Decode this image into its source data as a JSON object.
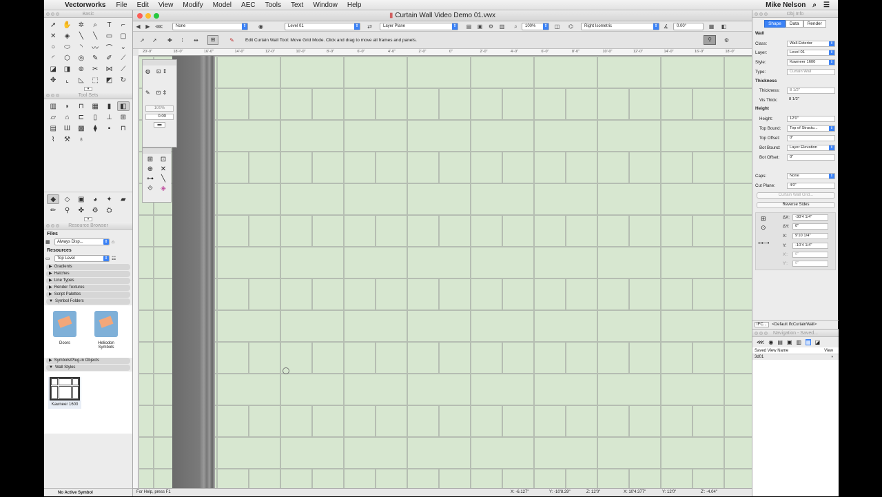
{
  "menubar": {
    "app": "Vectorworks",
    "items": [
      "File",
      "Edit",
      "View",
      "Modify",
      "Model",
      "AEC",
      "Tools",
      "Text",
      "Window",
      "Help"
    ],
    "user": "Mike Nelson"
  },
  "left": {
    "basic_title": "Basic",
    "toolsets_title": "Tool Sets",
    "rb_title": "Resource Browser",
    "files_label": "Files",
    "files_value": "Always Disp...",
    "resources_label": "Resources",
    "resources_value": "Top Level",
    "folders": [
      "Gradients",
      "Hatches",
      "Line Types",
      "Render Textures",
      "Script Palettes",
      "Symbol Folders"
    ],
    "symbol_items": [
      "Doors",
      "Heliodon Symbols"
    ],
    "folders2": [
      "Symbols/Plug-in Objects",
      "Wall Styles"
    ],
    "wall_style": "Kawneer 1600",
    "footer": "No Active Symbol"
  },
  "doc": {
    "title": "Curtain Wall Video Demo 01.vwx",
    "class_sel": "None",
    "layer_sel": "Level 01",
    "plane_sel": "Layer Plane",
    "zoom": "100%",
    "view_sel": "Right Isometric",
    "angle": "0.00°",
    "hint": "Edit Curtain Wall Tool: Move Grid Mode. Click and drag to move all frames and panels.",
    "help": "For Help, press F1",
    "ruler": [
      "20'-0\"",
      "18'-0\"",
      "16'-0\"",
      "14'-0\"",
      "12'-0\"",
      "10'-0\"",
      "8'-0\"",
      "6'-0\"",
      "4'-0\"",
      "2'-0\"",
      "0\"",
      "2'-0\"",
      "4'-0\"",
      "6'-0\"",
      "8'-0\"",
      "10'-0\"",
      "12'-0\"",
      "14'-0\"",
      "16'-0\"",
      "18'-0\""
    ],
    "status": {
      "x": "X: -6.127\"",
      "y": "Y: -10'8.29\"",
      "z": "Z: 12'0\"",
      "x2": "X: 10'4.377\"",
      "y2": "Y: 12'0\"",
      "z2": "Z': -4.04\""
    },
    "float_zoom": "100%",
    "float_val": "0.00"
  },
  "objinfo": {
    "title": "Obj Info",
    "tabs": [
      "Shape",
      "Data",
      "Render"
    ],
    "object": "Wall",
    "class": "Wall-Exterior",
    "layer": "Level 01",
    "style": "Kawneer 1600",
    "type": "Curtain Wall",
    "thickness_sec": "Thickness",
    "thickness": "8 1/2\"",
    "vis_thick": "8 1/2\"",
    "height_sec": "Height",
    "height": "12'0\"",
    "top_bound": "Top of Structu...",
    "top_offset": "0\"",
    "bot_bound": "Layer Elevation",
    "bot_offset": "0\"",
    "caps": "None",
    "cut_plane": "4'0\"",
    "grid_btn": "Curtain Wall Grid...",
    "reverse_btn": "Reverse Sides",
    "dx": "-30'4 1/4\"",
    "dy": "0\"",
    "x": "9'10 1/4\"",
    "y": "-10'4 1/4\"",
    "x2": "0\"",
    "y2": "0\"",
    "ifc_btn": "IFC...",
    "ifc_label": "<Default IfcCurtainWall>"
  },
  "nav": {
    "title": "Navigation - Saved...",
    "col1": "Saved View Name",
    "col2": "View",
    "row": "3d01"
  }
}
